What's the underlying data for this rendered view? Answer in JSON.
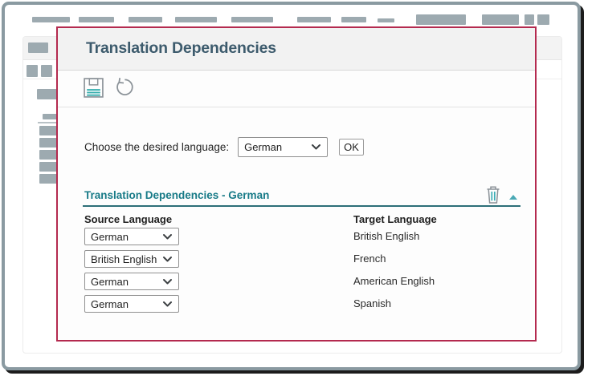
{
  "dialog": {
    "title": "Translation Dependencies",
    "language_chooser": {
      "label": "Choose the desired language:",
      "selected_language": "German",
      "ok_button": "OK"
    },
    "section": {
      "title": "Translation Dependencies - German"
    },
    "table": {
      "source_header": "Source Language",
      "target_header": "Target Language",
      "rows": [
        {
          "source": "German",
          "target": "British English"
        },
        {
          "source": "British English",
          "target": "French"
        },
        {
          "source": "German",
          "target": "American English"
        },
        {
          "source": "German",
          "target": "Spanish"
        }
      ]
    }
  },
  "icons": {
    "toolbar": [
      "save-icon",
      "undo-icon"
    ],
    "section": [
      "trash-icon",
      "chevron-up-icon"
    ],
    "dropdown": "chevron-down-icon"
  },
  "colors": {
    "dialog_border": "#b42a4f",
    "section_teal": "#177a87",
    "section_underline": "#2d6f78",
    "dialog_title": "#3d5b6d",
    "icon_teal": "#35adad",
    "frame_border": "#8a9aa1",
    "frame_shadow": "#1c1c1c",
    "placeholder_gray": "#9daab0",
    "header_band": "#f2f2f2"
  }
}
